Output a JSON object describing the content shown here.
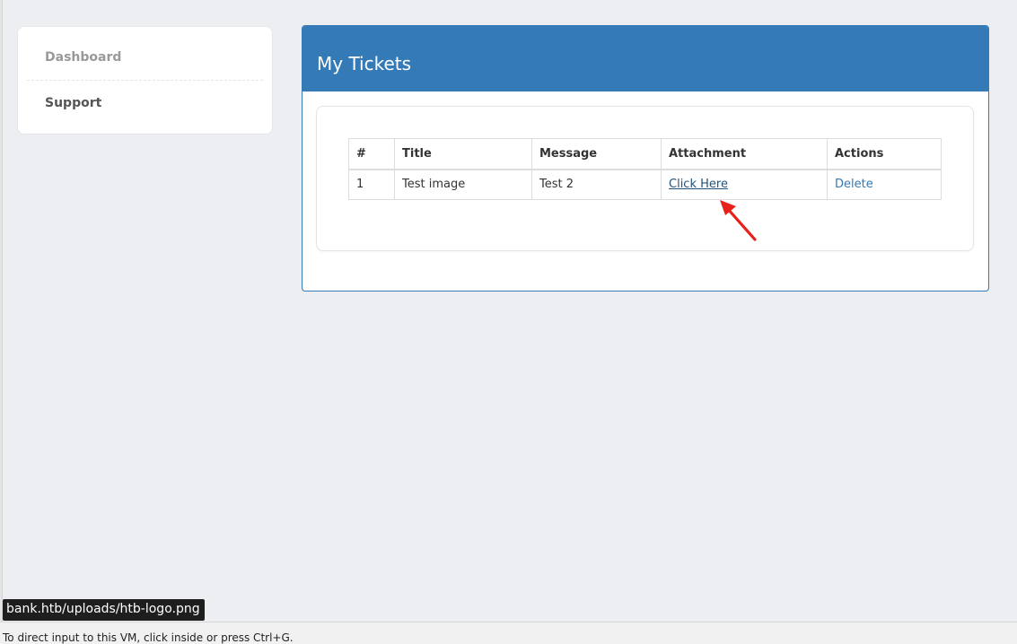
{
  "sidebar": {
    "items": [
      {
        "label": "Dashboard"
      },
      {
        "label": "Support"
      }
    ]
  },
  "panel": {
    "title": "My Tickets"
  },
  "table": {
    "headers": [
      "#",
      "Title",
      "Message",
      "Attachment",
      "Actions"
    ],
    "rows": [
      {
        "num": "1",
        "title": "Test image",
        "message": "Test 2",
        "attachment": "Click Here",
        "action": "Delete"
      }
    ]
  },
  "status": {
    "hover_url": "bank.htb/uploads/htb-logo.png",
    "vm_hint": "To direct input to this VM, click inside or press Ctrl+G."
  },
  "colors": {
    "panel_heading": "#337ab7",
    "annotation_arrow": "#e8201a"
  }
}
